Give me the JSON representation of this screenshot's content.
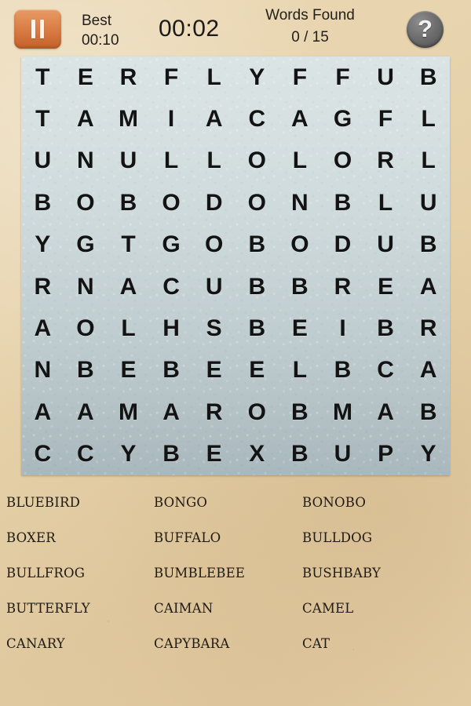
{
  "header": {
    "pause_button_label": "Pause",
    "pause_icon": "pause-icon",
    "best_label": "Best",
    "best_value": "00:10",
    "timer": "00:02",
    "words_found_label": "Words Found",
    "words_found_count": "0 / 15",
    "help_glyph": "?",
    "help_button_label": "Help"
  },
  "grid": {
    "rows": 10,
    "cols": 10,
    "letters": [
      [
        "T",
        "E",
        "R",
        "F",
        "L",
        "Y",
        "F",
        "F",
        "U",
        "B"
      ],
      [
        "T",
        "A",
        "M",
        "I",
        "A",
        "C",
        "A",
        "G",
        "F",
        "L"
      ],
      [
        "U",
        "N",
        "U",
        "L",
        "L",
        "O",
        "L",
        "O",
        "R",
        "L"
      ],
      [
        "B",
        "O",
        "B",
        "O",
        "D",
        "O",
        "N",
        "B",
        "L",
        "U"
      ],
      [
        "Y",
        "G",
        "T",
        "G",
        "O",
        "B",
        "O",
        "D",
        "U",
        "B"
      ],
      [
        "R",
        "N",
        "A",
        "C",
        "U",
        "B",
        "B",
        "R",
        "E",
        "A"
      ],
      [
        "A",
        "O",
        "L",
        "H",
        "S",
        "B",
        "E",
        "I",
        "B",
        "R"
      ],
      [
        "N",
        "B",
        "E",
        "B",
        "E",
        "E",
        "L",
        "B",
        "C",
        "A"
      ],
      [
        "A",
        "A",
        "M",
        "A",
        "R",
        "O",
        "B",
        "M",
        "A",
        "B"
      ],
      [
        "C",
        "C",
        "Y",
        "B",
        "E",
        "X",
        "B",
        "U",
        "P",
        "Y"
      ]
    ]
  },
  "word_list": {
    "words": [
      "BLUEBIRD",
      "BONGO",
      "BONOBO",
      "BOXER",
      "BUFFALO",
      "BULLDOG",
      "BULLFROG",
      "BUMBLEBEE",
      "BUSHBABY",
      "BUTTERFLY",
      "CAIMAN",
      "CAMEL",
      "CANARY",
      "CAPYBARA",
      "CAT"
    ]
  },
  "colors": {
    "paper": "#e7d3ad",
    "grid_top": "#dae4e4",
    "grid_bottom": "#a9b8bd",
    "pause_orange": "#d2703a",
    "help_gray": "#6f6f6f",
    "letter_ink": "#131313"
  }
}
